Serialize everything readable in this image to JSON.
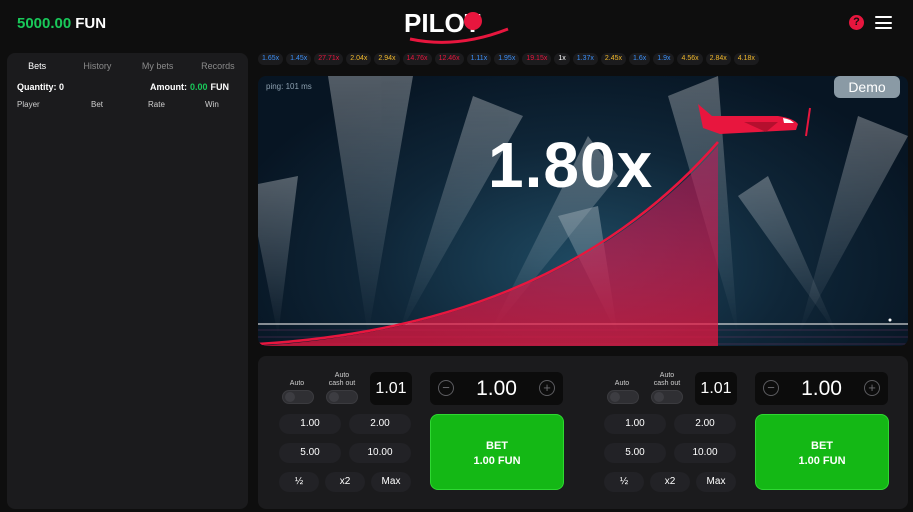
{
  "header": {
    "balance_amount": "5000.00",
    "balance_currency": "FUN",
    "logo_text": "PILOT",
    "help_icon": "?"
  },
  "left_panel": {
    "tabs": [
      "Bets",
      "History",
      "My bets",
      "Records"
    ],
    "active_tab": "Bets",
    "quantity_label": "Quantity:",
    "quantity_value": "0",
    "amount_label": "Amount:",
    "amount_value": "0.00",
    "amount_currency": "FUN",
    "columns": [
      "Player",
      "Bet",
      "Rate",
      "Win"
    ]
  },
  "history": [
    {
      "v": "1.65x",
      "c": "blue"
    },
    {
      "v": "1.45x",
      "c": "blue"
    },
    {
      "v": "27.71x",
      "c": "red"
    },
    {
      "v": "2.04x",
      "c": "yellow"
    },
    {
      "v": "2.94x",
      "c": "yellow"
    },
    {
      "v": "14.76x",
      "c": "red"
    },
    {
      "v": "12.46x",
      "c": "red"
    },
    {
      "v": "1.11x",
      "c": "blue"
    },
    {
      "v": "1.95x",
      "c": "blue"
    },
    {
      "v": "19.15x",
      "c": "red"
    },
    {
      "v": "1x",
      "c": "white"
    },
    {
      "v": "1.37x",
      "c": "blue"
    },
    {
      "v": "2.45x",
      "c": "yellow"
    },
    {
      "v": "1.6x",
      "c": "blue"
    },
    {
      "v": "1.9x",
      "c": "blue"
    },
    {
      "v": "4.56x",
      "c": "yellow"
    },
    {
      "v": "2.84x",
      "c": "yellow"
    },
    {
      "v": "4.18x",
      "c": "yellow"
    }
  ],
  "game": {
    "ping": "ping: 101 ms",
    "mode_badge": "Demo",
    "multiplier": "1.80x"
  },
  "bets": [
    {
      "auto_label": "Auto",
      "auto_cashout_label_1": "Auto",
      "auto_cashout_label_2": "cash out",
      "cashout_value": "1.01",
      "stake_value": "1.00",
      "quick": [
        "1.00",
        "2.00",
        "5.00",
        "10.00"
      ],
      "mods": [
        "½",
        "x2",
        "Max"
      ],
      "bet_label": "BET",
      "bet_amount": "1.00 FUN"
    },
    {
      "auto_label": "Auto",
      "auto_cashout_label_1": "Auto",
      "auto_cashout_label_2": "cash out",
      "cashout_value": "1.01",
      "stake_value": "1.00",
      "quick": [
        "1.00",
        "2.00",
        "5.00",
        "10.00"
      ],
      "mods": [
        "½",
        "x2",
        "Max"
      ],
      "bet_label": "BET",
      "bet_amount": "1.00 FUN"
    }
  ],
  "colors": {
    "accent_green": "#19c95a",
    "accent_red": "#e8163e",
    "bet_button": "#14b815"
  }
}
